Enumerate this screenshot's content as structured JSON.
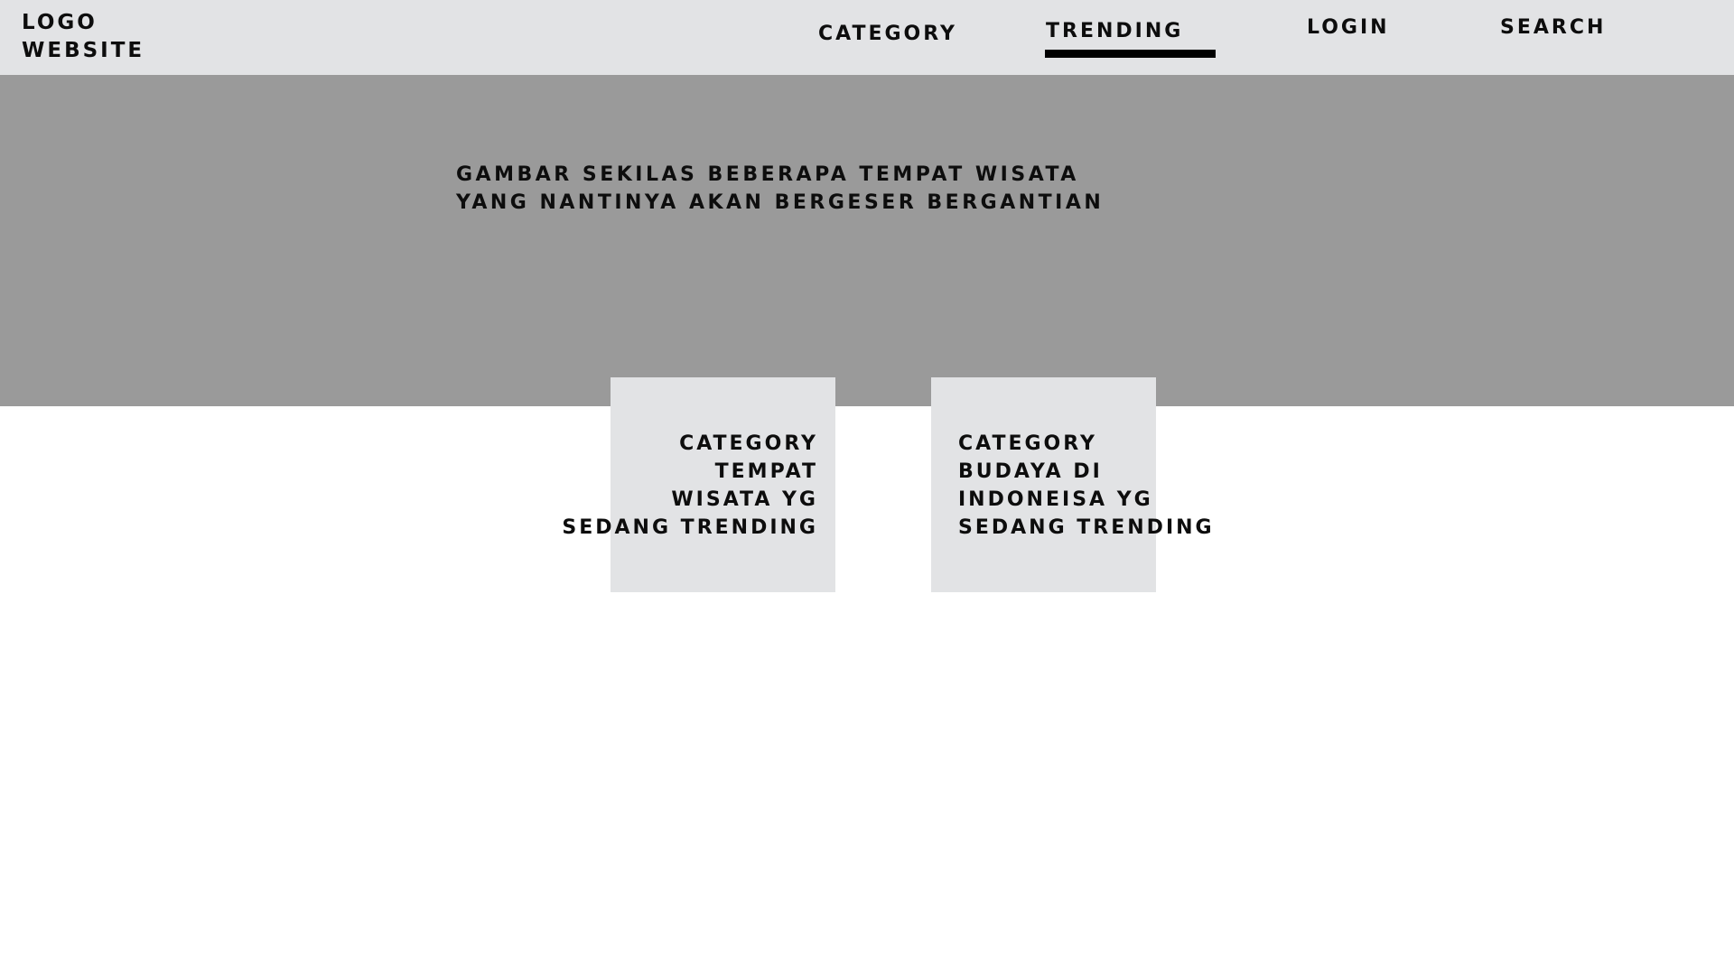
{
  "header": {
    "logo_lines": [
      "LOGO",
      "WEBSITE"
    ],
    "nav": {
      "category": "CATEGORY",
      "trending": "TRENDING",
      "login": "LOGIN",
      "search": "SEARCH"
    },
    "active_tab": "trending"
  },
  "hero": {
    "lines": [
      "GAMBAR SEKILAS BEBERAPA TEMPAT WISATA",
      "YANG NANTINYA AKAN BERGESER BERGANTIAN"
    ]
  },
  "cards": [
    {
      "lines": [
        "CATEGORY",
        "TEMPAT",
        "WISATA YG",
        "SEDANG TRENDING"
      ]
    },
    {
      "lines": [
        "CATEGORY",
        "BUDAYA DI",
        "INDONEISA YG",
        "SEDANG TRENDING"
      ]
    }
  ],
  "colors": {
    "nav_background": "#e2e3e5",
    "hero_background": "#9a9a9a",
    "card_background": "#e2e3e5",
    "text": "#0d0d0d",
    "active_underline": "#000000"
  }
}
